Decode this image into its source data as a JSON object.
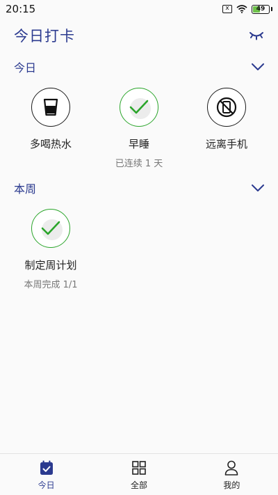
{
  "status_bar": {
    "time": "20:15",
    "notification_glyph": "x",
    "battery_level": "49",
    "battery_fraction": 0.49
  },
  "header": {
    "title": "今日打卡",
    "toggle_icon": "closed-eye-icon"
  },
  "sections": [
    {
      "title": "今日",
      "expand_icon": "chevron-down-icon"
    },
    {
      "title": "本周",
      "expand_icon": "chevron-down-icon"
    }
  ],
  "today_habits": [
    {
      "name": "多喝热水",
      "icon": "water-glass-icon",
      "done": false,
      "subtitle": ""
    },
    {
      "name": "早睡",
      "icon": "checkmark-icon",
      "done": true,
      "subtitle": "已连续 1 天"
    },
    {
      "name": "远离手机",
      "icon": "no-phone-icon",
      "done": false,
      "subtitle": ""
    }
  ],
  "week_habits": [
    {
      "name": "制定周计划",
      "icon": "checkmark-icon",
      "done": true,
      "subtitle": "本周完成 1/1"
    }
  ],
  "tabbar": {
    "items": [
      {
        "label": "今日",
        "icon": "calendar-check-icon",
        "active": true
      },
      {
        "label": "全部",
        "icon": "grid-icon",
        "active": false
      },
      {
        "label": "我的",
        "icon": "profile-icon",
        "active": false
      }
    ]
  },
  "colors": {
    "accent": "#2b3a8f",
    "done": "#2aa52a",
    "text": "#222222",
    "muted": "#777777"
  }
}
